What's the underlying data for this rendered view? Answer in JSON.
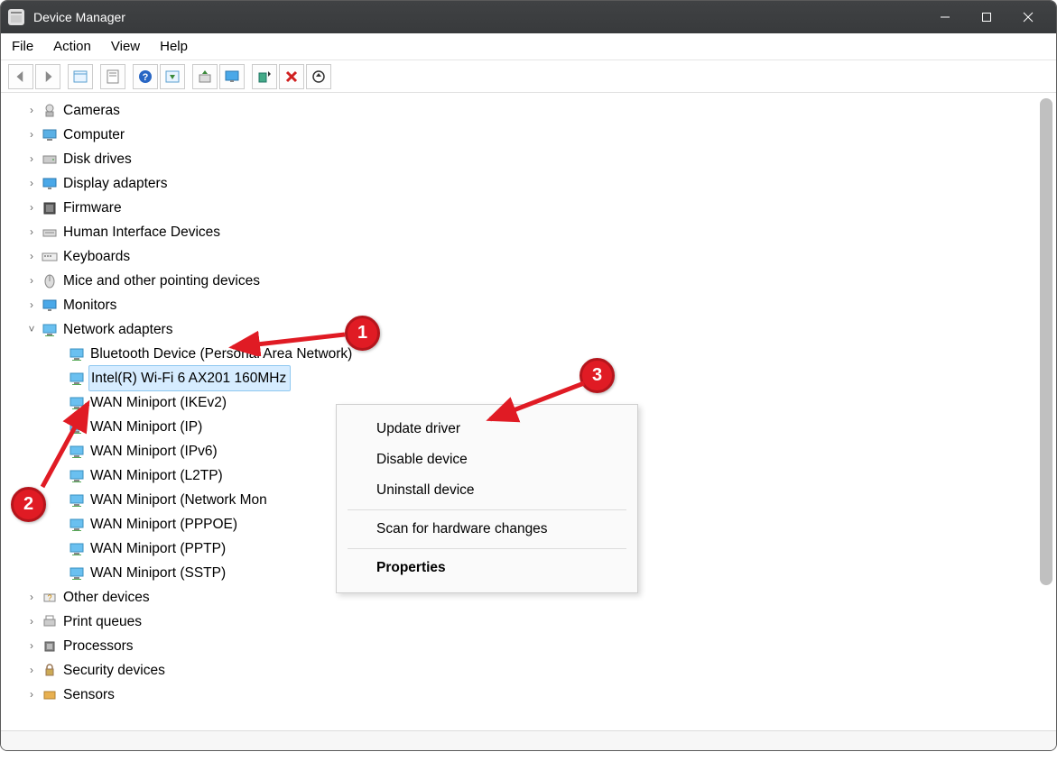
{
  "window": {
    "title": "Device Manager"
  },
  "menu": {
    "file": "File",
    "action": "Action",
    "view": "View",
    "help": "Help"
  },
  "toolbar_icons": [
    "back",
    "forward",
    "sep",
    "properties",
    "sep",
    "sheet",
    "sep",
    "help",
    "mini",
    "sep",
    "update",
    "monitor",
    "sep",
    "enable",
    "remove",
    "scan"
  ],
  "tree": [
    {
      "label": "Cameras",
      "icon": "camera"
    },
    {
      "label": "Computer",
      "icon": "computer"
    },
    {
      "label": "Disk drives",
      "icon": "disk"
    },
    {
      "label": "Display adapters",
      "icon": "display"
    },
    {
      "label": "Firmware",
      "icon": "firmware"
    },
    {
      "label": "Human Interface Devices",
      "icon": "hid"
    },
    {
      "label": "Keyboards",
      "icon": "keyboard"
    },
    {
      "label": "Mice and other pointing devices",
      "icon": "mouse"
    },
    {
      "label": "Monitors",
      "icon": "monitor"
    },
    {
      "label": "Network adapters",
      "icon": "net",
      "expanded": true,
      "children": [
        {
          "label": "Bluetooth Device (Personal Area Network)"
        },
        {
          "label": "Intel(R) Wi-Fi 6 AX201 160MHz",
          "selected": true
        },
        {
          "label": "WAN Miniport (IKEv2)"
        },
        {
          "label": "WAN Miniport (IP)"
        },
        {
          "label": "WAN Miniport (IPv6)"
        },
        {
          "label": "WAN Miniport (L2TP)"
        },
        {
          "label": "WAN Miniport (Network Mon"
        },
        {
          "label": "WAN Miniport (PPPOE)"
        },
        {
          "label": "WAN Miniport (PPTP)"
        },
        {
          "label": "WAN Miniport (SSTP)"
        }
      ]
    },
    {
      "label": "Other devices",
      "icon": "other"
    },
    {
      "label": "Print queues",
      "icon": "print"
    },
    {
      "label": "Processors",
      "icon": "cpu"
    },
    {
      "label": "Security devices",
      "icon": "security"
    },
    {
      "label": "Sensors",
      "icon": "sensor"
    }
  ],
  "context_menu": {
    "update": "Update driver",
    "disable": "Disable device",
    "uninstall": "Uninstall device",
    "scan": "Scan for hardware changes",
    "props": "Properties"
  },
  "annotations": {
    "a1": "1",
    "a2": "2",
    "a3": "3"
  }
}
